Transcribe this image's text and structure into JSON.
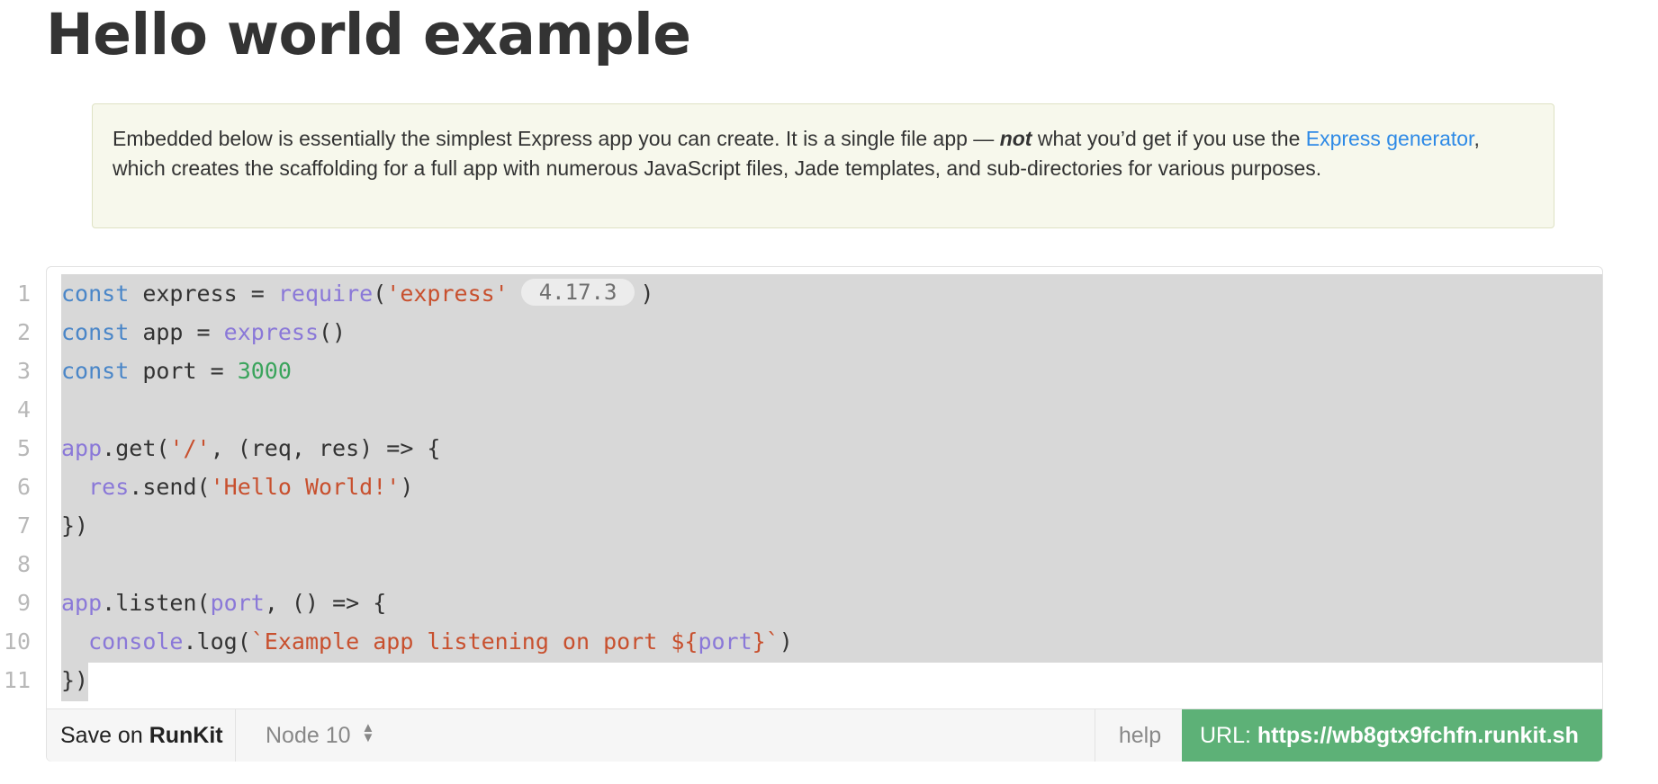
{
  "title": "Hello world example",
  "note": {
    "text_before": "Embedded below is essentially the simplest Express app you can create. It is a single file app — ",
    "emphasis": "not",
    "text_middle": " what you’d get if you use the ",
    "link": "Express generator",
    "text_after": ", which creates the scaffolding for a full app with numerous JavaScript files, Jade templates, and sub-directories for various purposes."
  },
  "code": {
    "line_numbers": [
      "1",
      "2",
      "3",
      "4",
      "5",
      "6",
      "7",
      "8",
      "9",
      "10",
      "11"
    ],
    "version_badge": "4.17.3",
    "tokens": {
      "const": "const",
      "express": "express",
      "require": "require",
      "express_str": "'express'",
      "app": "app",
      "port": "port",
      "port_val": "3000",
      "get": "get",
      "slash": "'/'",
      "req_res": "(req, res)",
      "res": "res",
      "send": "send",
      "hello": "'Hello World!'",
      "listen": "listen",
      "console": "console",
      "log": "log",
      "tpl_start": "`Example app listening on port ${",
      "tpl_end": "}`"
    }
  },
  "toolbar": {
    "save_prefix": "Save on ",
    "save_brand": "RunKit",
    "node_version": "Node 10",
    "help": "help",
    "url_label": "URL: ",
    "url_value": "https://wb8gtx9fchfn.runkit.sh"
  },
  "colors": {
    "keyword": "#4a86c8",
    "function": "#8a78d8",
    "string": "#c8502e",
    "number": "#3aa45c",
    "url_button": "#5db177",
    "link": "#2e8ae6"
  },
  "icons": {
    "node_select": "chevron-updown-icon"
  }
}
